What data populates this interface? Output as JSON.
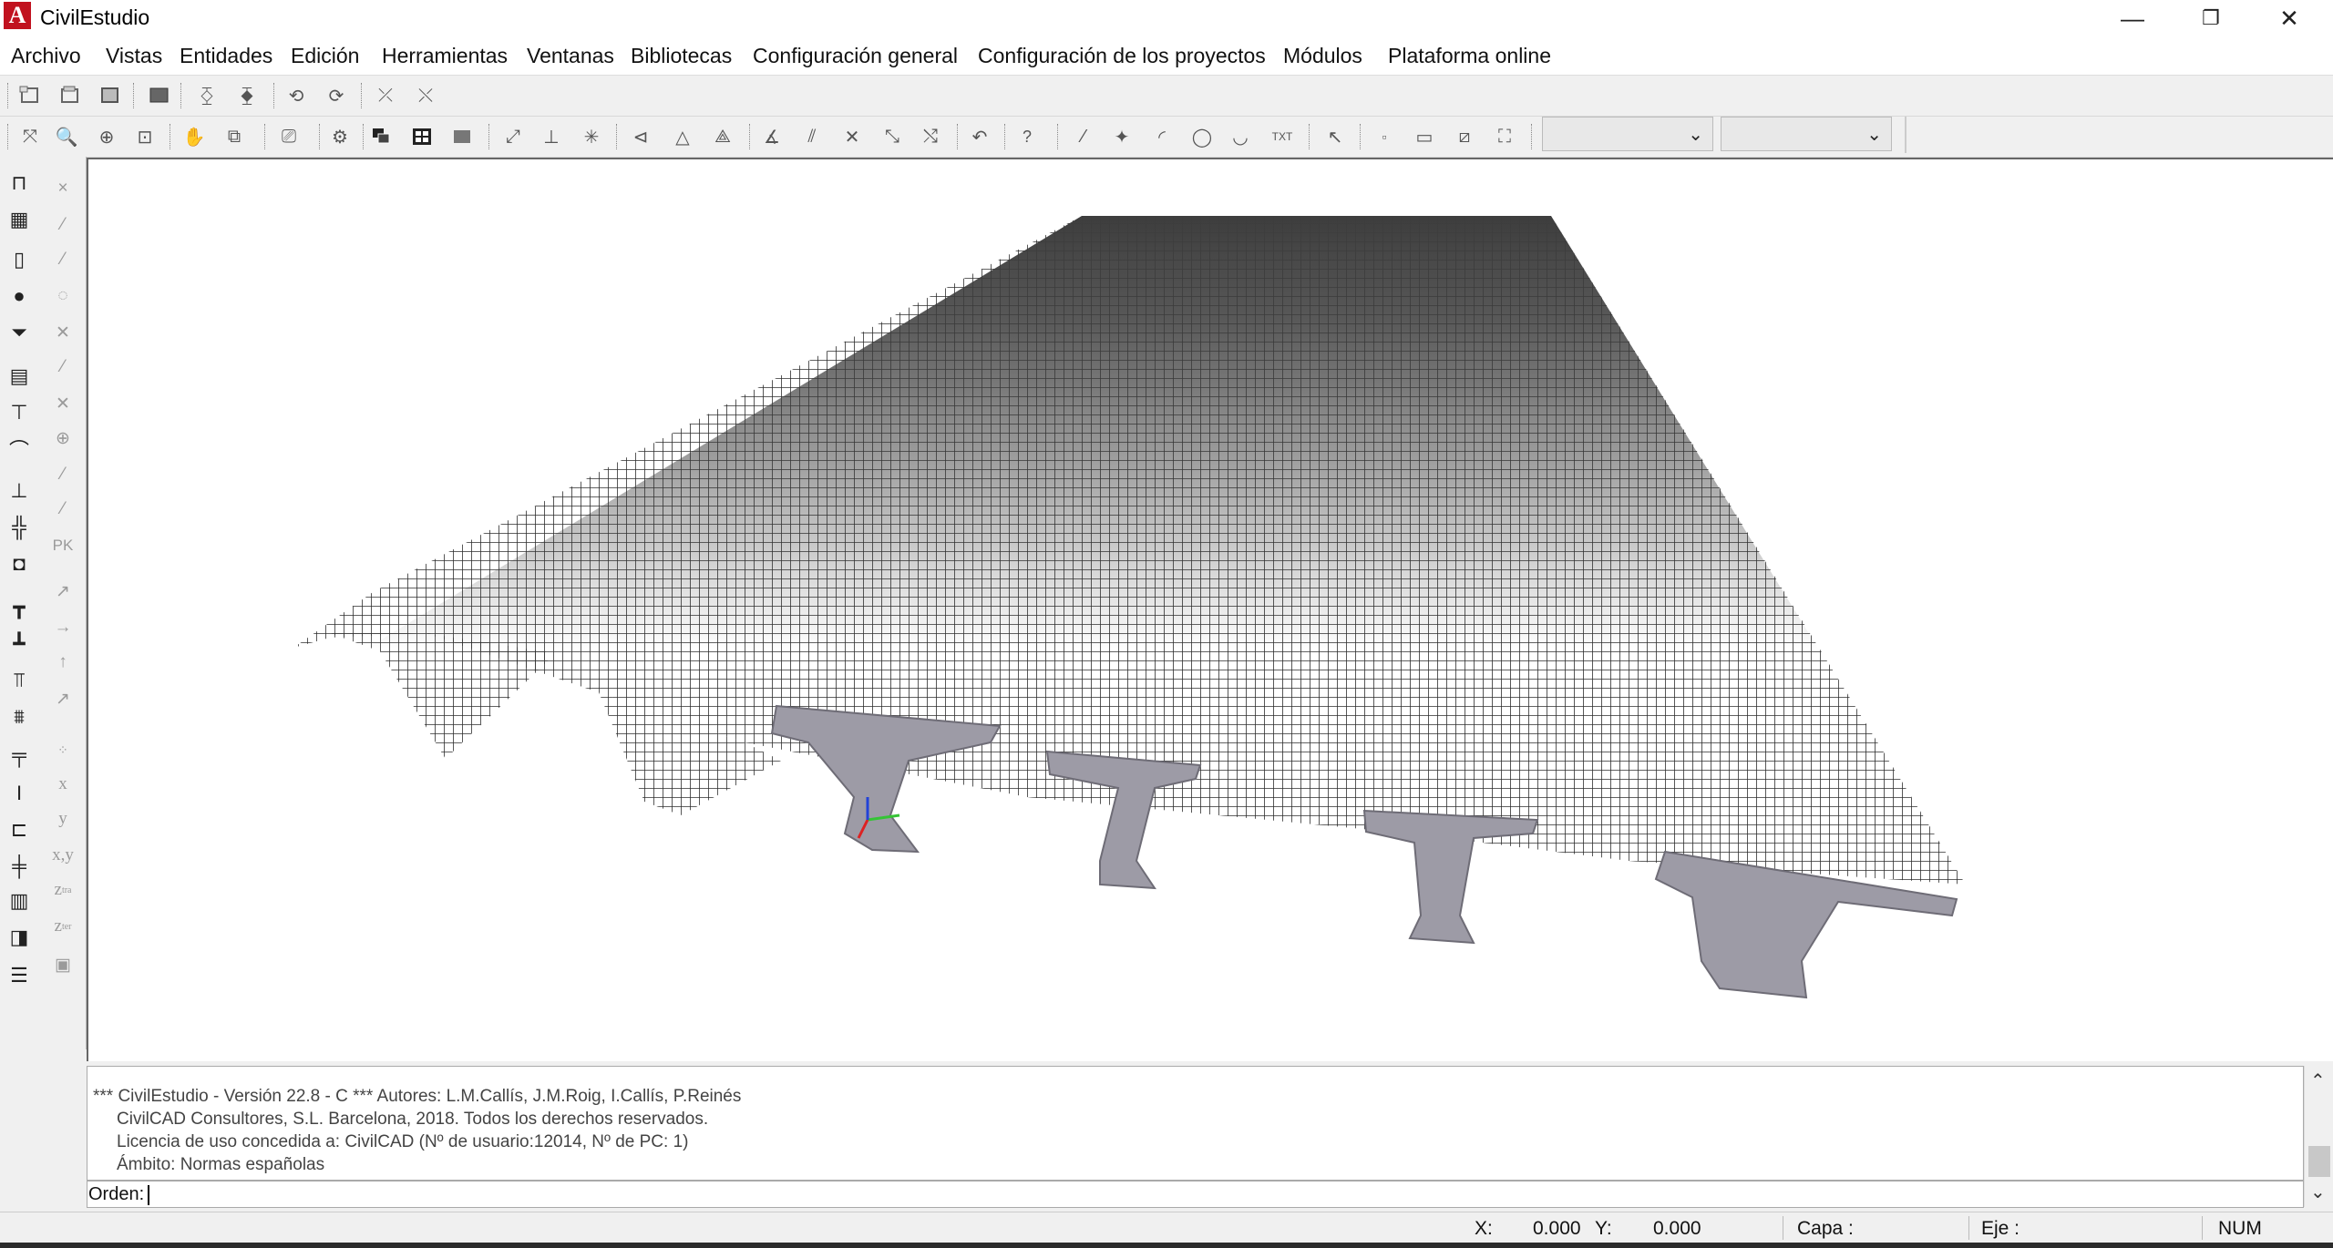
{
  "window": {
    "title": "CivilEstudio",
    "logo_letter": "A",
    "minimize_glyph": "—",
    "restore_glyph": "❐",
    "close_glyph": "✕"
  },
  "menu": [
    "Archivo",
    "Vistas",
    "Entidades",
    "Edición",
    "Herramientas",
    "Ventanas",
    "Bibliotecas",
    "Configuración general",
    "Configuración de los proyectos",
    "Módulos",
    "Plataforma online"
  ],
  "toolbar": {
    "left_glyphs": [
      "PK",
      "x",
      "y",
      "x,y",
      "z"
    ],
    "left_sub": [
      "tra",
      "ter"
    ],
    "text_tool": "TXT",
    "query_tool": "?"
  },
  "command": {
    "lines": [
      "*** CivilEstudio - Versión 22.8 - C *** Autores: L.M.Callís, J.M.Roig, I.Callís, P.Reinés",
      "CivilCAD Consultores, S.L. Barcelona, 2018. Todos los derechos reservados.",
      "Licencia de uso concedida a: CivilCAD  (Nº de usuario:12014, Nº de PC: 1)",
      "Ámbito: Normas españolas"
    ],
    "prompt_label": "Orden:",
    "prompt_value": ""
  },
  "status": {
    "x_label": "X:",
    "x_value": "0.000",
    "y_label": "Y:",
    "y_value": "0.000",
    "layer_label": "Capa :",
    "layer_value": "",
    "axis_label": "Eje :",
    "axis_value": "",
    "num_indicator": "NUM"
  },
  "icons": [
    "app-logo-icon",
    "minimize-icon",
    "restore-icon",
    "close-icon",
    "new-icon",
    "open-icon",
    "save-icon",
    "pan-icon",
    "zoom-icon",
    "undo-icon",
    "line-icon",
    "point-icon",
    "arc-icon",
    "circle-icon",
    "arrow-icon",
    "combo-chevron-icon",
    "scroll-up-icon",
    "scroll-down-icon"
  ],
  "colors": {
    "logo": "#c1121f",
    "deck_top": "#3d3d3d",
    "girder": "#9d9ba6",
    "mesh": "#2e2e2e"
  }
}
